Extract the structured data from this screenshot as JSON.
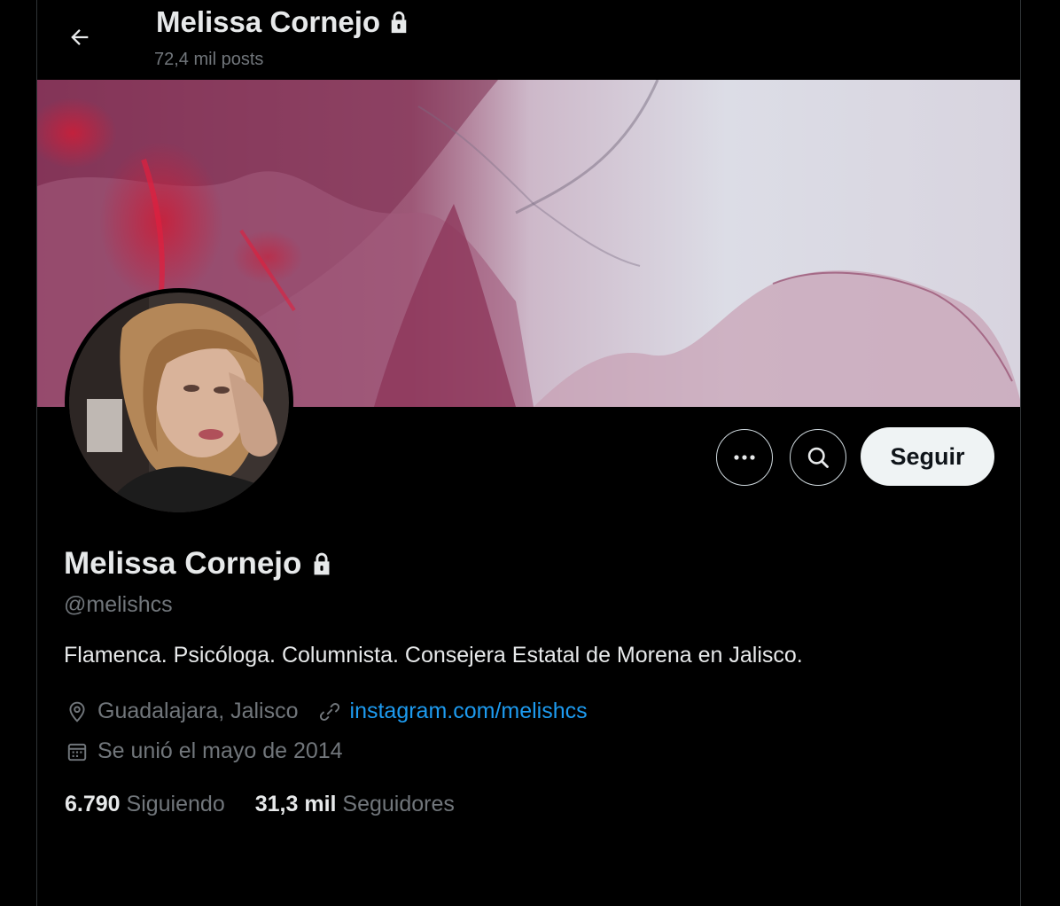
{
  "header": {
    "back_icon": "arrow-left-icon",
    "name": "Melissa Cornejo",
    "posts": "72,4 mil posts",
    "lock_icon": "lock-icon"
  },
  "actions": {
    "more_icon": "more-icon",
    "search_icon": "search-icon",
    "follow_label": "Seguir"
  },
  "profile": {
    "name": "Melissa Cornejo",
    "handle": "@melishcs",
    "bio": "Flamenca. Psicóloga. Columnista. Consejera Estatal de Morena en Jalisco.",
    "location": "Guadalajara, Jalisco",
    "location_icon": "location-pin-icon",
    "link_icon": "link-icon",
    "website": "instagram.com/melishcs",
    "joined_icon": "calendar-icon",
    "joined": "Se unió el mayo de 2014"
  },
  "stats": {
    "following_count": "6.790",
    "following_label": "Siguiendo",
    "followers_count": "31,3 mil",
    "followers_label": "Seguidores"
  },
  "colors": {
    "background": "#000000",
    "text": "#e7e9ea",
    "muted": "#71767b",
    "link": "#1d9bf0",
    "button": "#eff3f4"
  }
}
